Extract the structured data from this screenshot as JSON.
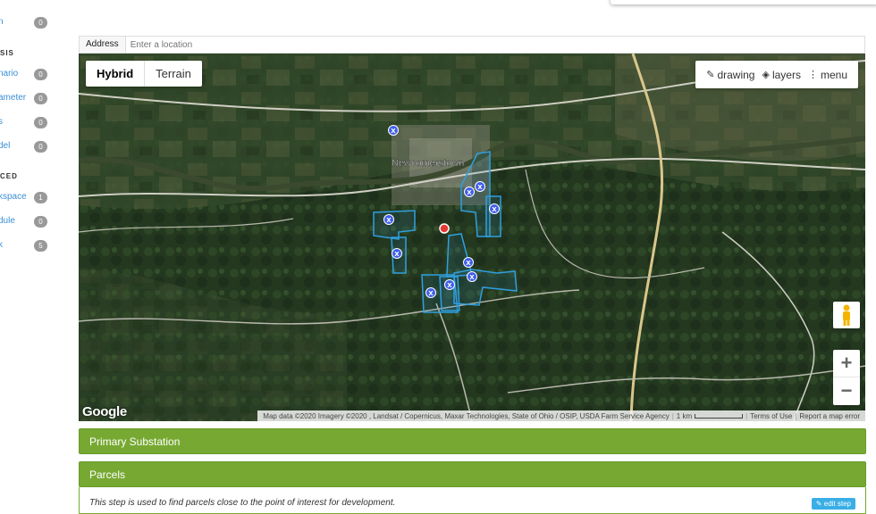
{
  "sidebar": {
    "items_top": [
      {
        "label": "n",
        "count": "0"
      }
    ],
    "section_analysis": "SIS",
    "analysis_items": [
      {
        "label": "nario",
        "count": "0"
      },
      {
        "label": "ameter",
        "count": "0"
      },
      {
        "label": "s",
        "count": "0"
      },
      {
        "label": "del",
        "count": "0"
      }
    ],
    "section_advanced": "CED",
    "advanced_items": [
      {
        "label": "kspace",
        "count": "1"
      },
      {
        "label": "dule",
        "count": "0"
      },
      {
        "label": "k",
        "count": "5"
      }
    ]
  },
  "address": {
    "label": "Address",
    "placeholder": "Enter a location"
  },
  "map": {
    "type_buttons": [
      "Hybrid",
      "Terrain"
    ],
    "active_type": "Hybrid",
    "toolbar": {
      "drawing": "drawing",
      "layers": "layers",
      "menu": "menu"
    },
    "town_label": "Newcomerstown",
    "google_logo": "Google",
    "attribution": {
      "data": "Map data ©2020 Imagery ©2020 , Landsat / Copernicus, Maxar Technologies, State of Ohio / OSIP, USDA Farm Service Agency",
      "scale": "1 km",
      "terms": "Terms of Use",
      "report": "Report a map error"
    },
    "zoom_in": "+",
    "zoom_out": "−",
    "accent_parcel": "#2fa0e0",
    "marker_color": "#3f5fe8"
  },
  "panels": {
    "primary_substation": "Primary Substation",
    "parcels": "Parcels",
    "parcels_text": "This step is used to find parcels close to the point of interest for development.",
    "edit_step": "edit step"
  }
}
